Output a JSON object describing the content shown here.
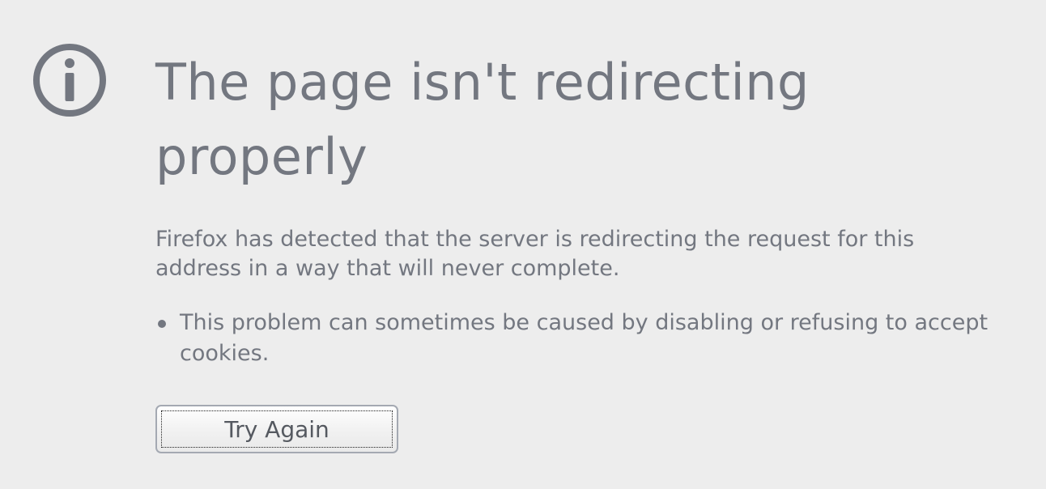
{
  "error_page": {
    "title": "The page isn't redirecting properly",
    "description": "Firefox has detected that the server is redirecting the request for this address in a way that will never complete.",
    "suggestions": [
      "This problem can sometimes be caused by disabling or refusing to accept cookies."
    ],
    "try_again_label": "Try Again",
    "icon": "info-icon",
    "text_color": "#737780",
    "background_color": "#ededed"
  }
}
